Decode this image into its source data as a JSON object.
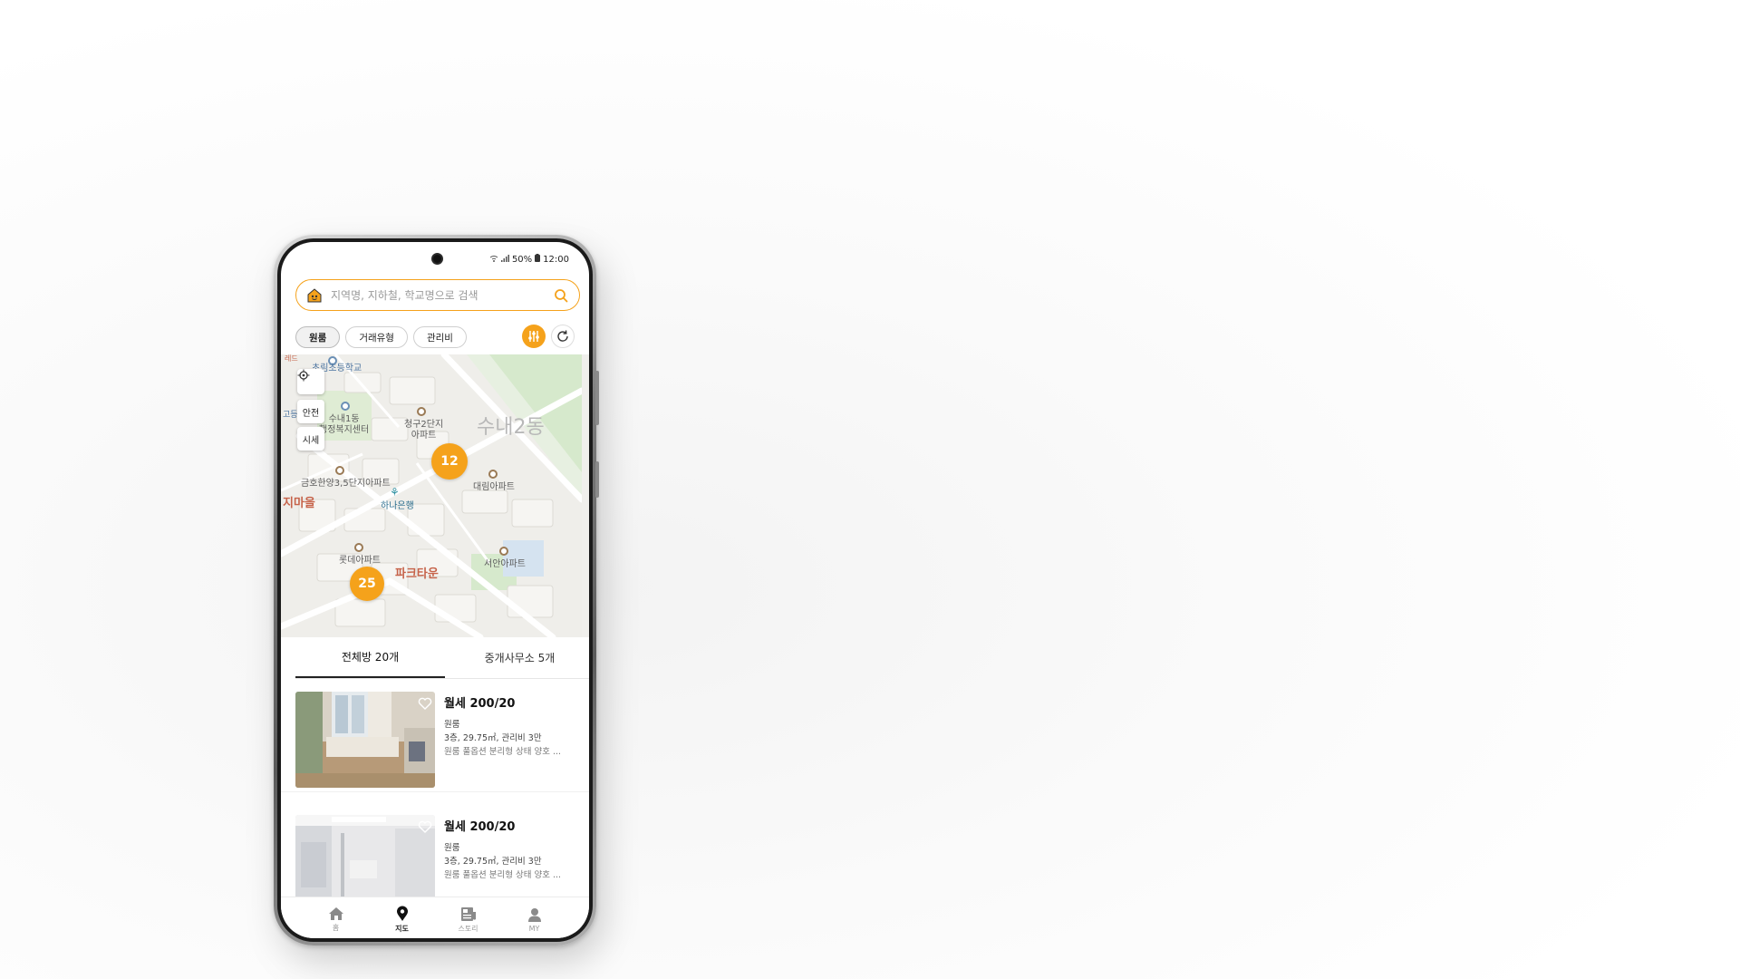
{
  "status_bar": {
    "battery": "50%",
    "time": "12:00"
  },
  "search": {
    "placeholder": "지역명, 지하철, 학교명으로 검색"
  },
  "filters": {
    "chips": [
      "원룸",
      "거래유형",
      "관리비"
    ]
  },
  "map": {
    "controls": {
      "safety": "안전",
      "price": "시세"
    },
    "labels": {
      "school": "초림초등학교",
      "community_center": "수내1동\n행정복지센터",
      "apt_cheonggu": "청구2단지\n아파트",
      "district": "수내2동",
      "apt_geumho": "금호한양3,5단지아파트",
      "apt_daerim": "대림아파트",
      "village": "지마을",
      "bank": "하나은행",
      "apt_lotte": "롯데아파트",
      "apt_seoan": "서안아파트",
      "parktown": "파크타운",
      "school_left": "고등학교",
      "top_left": "레드"
    },
    "clusters": [
      {
        "count": "12"
      },
      {
        "count": "25"
      }
    ]
  },
  "tabs": [
    {
      "label": "전체방 20개",
      "active": true
    },
    {
      "label": "중개사무소 5개",
      "active": false
    }
  ],
  "listings": [
    {
      "price": "월세 200/20",
      "type": "원룸",
      "spec": "3층, 29.75㎡, 관리비 3만",
      "desc": "원룸 풀옵션 분리형 상태 양호 ..."
    },
    {
      "price": "월세 200/20",
      "type": "원룸",
      "spec": "3층, 29.75㎡, 관리비 3만",
      "desc": "원룸 풀옵션 분리형 상태 양호 ..."
    }
  ],
  "bottom_nav": [
    {
      "label": "홈",
      "icon": "home-icon",
      "active": false
    },
    {
      "label": "지도",
      "icon": "map-pin-icon",
      "active": true
    },
    {
      "label": "스토리",
      "icon": "story-icon",
      "active": false
    },
    {
      "label": "MY",
      "icon": "user-icon",
      "active": false
    }
  ],
  "colors": {
    "accent": "#f5a21b",
    "text": "#222222",
    "map_bg": "#f0efec",
    "park": "#d6e9cc"
  }
}
